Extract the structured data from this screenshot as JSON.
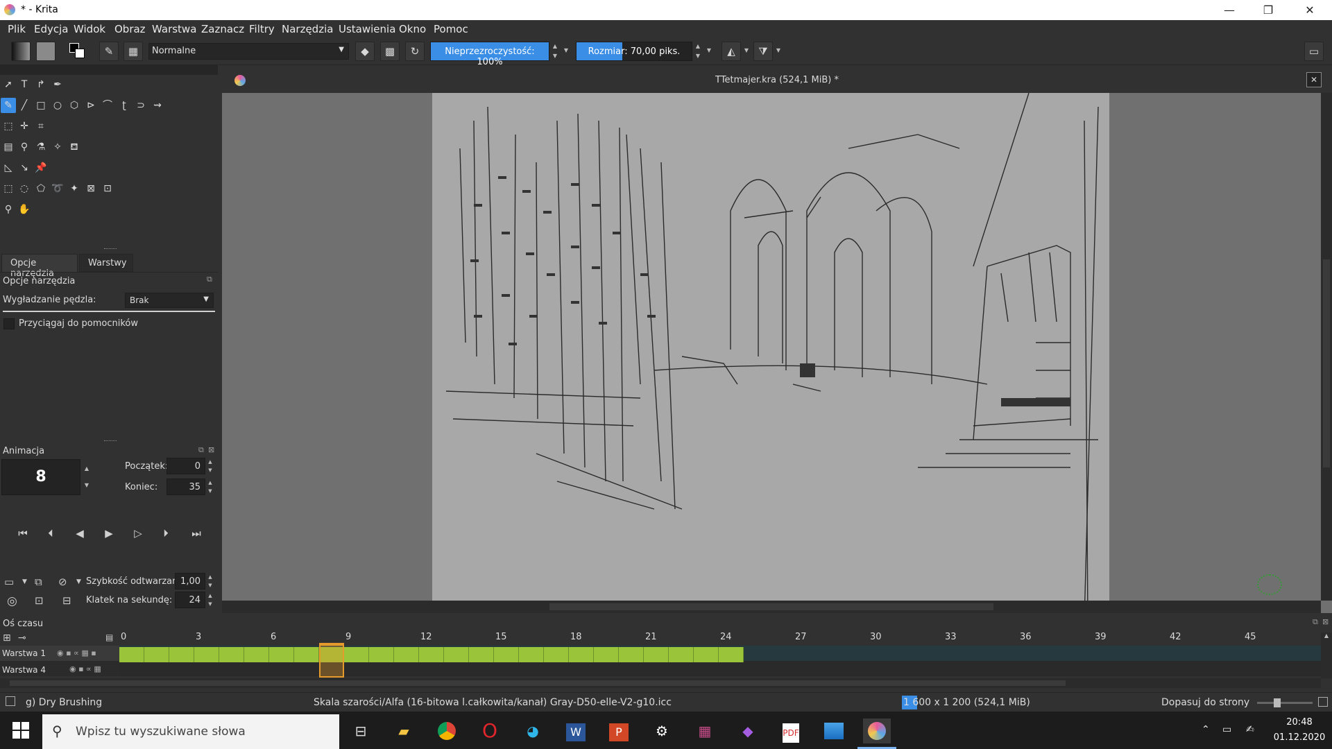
{
  "window": {
    "title": "* - Krita",
    "minimize": "—",
    "maximize": "❐",
    "close": "✕"
  },
  "menu": [
    "Plik",
    "Edycja",
    "Widok",
    "Obraz",
    "Warstwa",
    "Zaznacz",
    "Filtry",
    "Narzędzia",
    "Ustawienia",
    "Okno",
    "Pomoc"
  ],
  "toolbar": {
    "blend_mode": "Normalne",
    "opacity_label": "Nieprzezroczystość: 100%",
    "opacity_fraction": 1.0,
    "size_label": "Rozmiar: 70,00 piks.",
    "size_fraction": 0.4
  },
  "left_dock": {
    "tabs": [
      "Opcje narzędzia",
      "Warstwy"
    ],
    "tool_options_title": "Opcje narzędzia",
    "smoothing_label": "Wygładzanie pędzla:",
    "smoothing_value": "Brak",
    "snap_label": "Przyciągaj do pomocników",
    "animation_title": "Animacja",
    "current_frame": "8",
    "start_label": "Początek:",
    "start_value": "0",
    "end_label": "Koniec:",
    "end_value": "35",
    "playback_speed_label": "Szybkość odtwarzania:",
    "playback_speed_value": "1,00",
    "fps_label": "Klatek na sekundę:",
    "fps_value": "24"
  },
  "document": {
    "title": "TTetmajer.kra (524,1 MiB) *"
  },
  "timeline": {
    "title": "Oś czasu",
    "ticks": [
      "0",
      "3",
      "6",
      "9",
      "12",
      "15",
      "18",
      "21",
      "24",
      "27",
      "30",
      "33",
      "36",
      "39",
      "42",
      "45"
    ],
    "layers": [
      "Warstwa 1",
      "Warstwa 4"
    ],
    "filled_frames": 25,
    "current_frame_index": 8
  },
  "statusbar": {
    "brush": "g) Dry Brushing",
    "colorspace": "Skala szarości/Alfa (16-bitowa l.całkowita/kanał)  Gray-D50-elle-V2-g10.icc",
    "dimensions": "1 600 x 1 200 (524,1 MiB)",
    "zoom": "Dopasuj do strony"
  },
  "taskbar": {
    "search_placeholder": "Wpisz tu wyszukiwane słowa",
    "time": "20:48",
    "date": "01.12.2020"
  },
  "colors": {
    "accent": "#3a8ee6",
    "frame_fill": "#9ac43a",
    "current_frame": "#e59b2c"
  }
}
